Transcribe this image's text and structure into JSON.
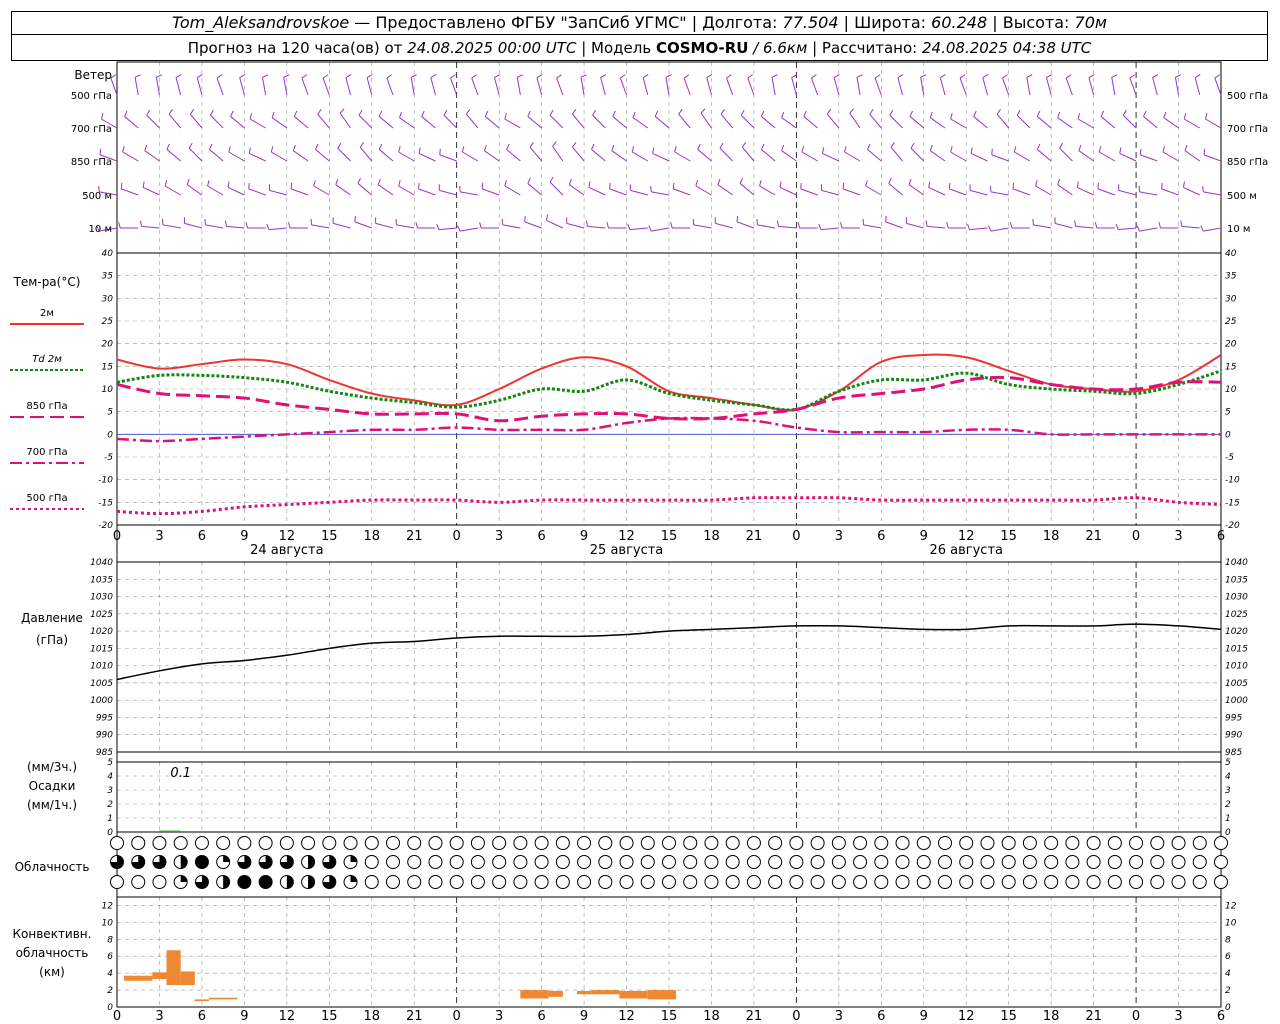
{
  "header": {
    "station": "Tom_Aleksandrovskoe",
    "provider": "— Предоставлено ФГБУ \"ЗапСиб УГМС\"",
    "lon_label": "Долгота:",
    "lon": "77.504",
    "lat_label": "Широта:",
    "lat": "60.248",
    "alt_label": "Высота:",
    "alt": "70м",
    "forecast_prefix": "Прогноз на 120 часа(ов) от",
    "forecast_start": "24.08.2025 00:00 UTC",
    "model_label": "Модель",
    "model": "COSMO-RU",
    "resolution": "/ 6.6км",
    "calc_label": "Рассчитано:",
    "calc_time": "24.08.2025 04:38 UTC"
  },
  "x_axis": {
    "hour_ticks": [
      "0",
      "3",
      "6",
      "9",
      "12",
      "15",
      "18",
      "21",
      "0",
      "3",
      "6",
      "9",
      "12",
      "15",
      "18",
      "21",
      "0",
      "3",
      "6",
      "9",
      "12",
      "15",
      "18",
      "21",
      "0",
      "3",
      "6"
    ],
    "days": [
      "24 августа",
      "25 августа",
      "26 августа"
    ]
  },
  "labels": {
    "wind_title": "Ветер",
    "wind_levels": [
      "500 гПа",
      "700 гПа",
      "850 гПа",
      "500 м",
      "10 м"
    ],
    "temp_title": "Тем-ра(°C)",
    "temp_legend": [
      "2м",
      "Td 2м",
      "850 гПа",
      "700 гПа",
      "500 гПа"
    ],
    "pressure_title": "Давление",
    "pressure_unit": "(гПа)",
    "precip_lines": [
      "(мм/3ч.)",
      "Осадки",
      "(мм/1ч.)"
    ],
    "precip_annotation": "0.1",
    "cloud_title": "Облачность",
    "conv_lines": [
      "Конвективн.",
      "облачность",
      "(км)"
    ]
  },
  "colors": {
    "t2m": "#ee3333",
    "td2m": "#118811",
    "t850": "#dd1177",
    "t700": "#dd1177",
    "t500": "#dd1177",
    "pressure": "#000000",
    "wind": "#9933cc",
    "precip": "#22aa22",
    "conv": "#ee8833",
    "zero_line": "#3344cc"
  },
  "chart_data": [
    {
      "type": "line",
      "ylabel": "Тем-ра(°C)",
      "ylim": [
        -20,
        40
      ],
      "y_ticks": [
        -20,
        -15,
        -10,
        -5,
        0,
        5,
        10,
        15,
        20,
        25,
        30,
        35,
        40
      ],
      "x_hours": [
        0,
        3,
        6,
        9,
        12,
        15,
        18,
        21,
        24,
        27,
        30,
        33,
        36,
        39,
        42,
        45,
        48,
        51,
        54,
        57,
        60,
        63,
        66,
        69,
        72,
        75,
        78
      ],
      "grid": true,
      "series": [
        {
          "name": "2м",
          "values": [
            16.5,
            14.5,
            15.5,
            16.5,
            15.5,
            12,
            9,
            7.5,
            6.5,
            10,
            14.5,
            17,
            15,
            9.5,
            8,
            6.5,
            5.5,
            9.5,
            16,
            17.5,
            17,
            14,
            11,
            10,
            9.5,
            12,
            17.5
          ]
        },
        {
          "name": "Td 2м",
          "values": [
            11.5,
            13,
            13,
            12.5,
            11.5,
            9.5,
            8,
            7,
            6,
            7.5,
            10,
            9.5,
            12,
            9,
            7.5,
            6.5,
            5.5,
            9.5,
            12,
            12,
            13.5,
            11,
            10,
            9.5,
            9,
            11,
            14
          ]
        },
        {
          "name": "850 гПа",
          "values": [
            11,
            9,
            8.5,
            8,
            6.5,
            5.5,
            4.5,
            4.5,
            4.5,
            3,
            4,
            4.5,
            4.5,
            3.5,
            3.5,
            4.5,
            5.5,
            8,
            9,
            10,
            12,
            12.5,
            11,
            10,
            10,
            11.5,
            11.5
          ]
        },
        {
          "name": "700 гПа",
          "values": [
            -1,
            -1.5,
            -1,
            -0.5,
            0,
            0.5,
            1,
            1,
            1.5,
            1,
            1,
            1,
            2.5,
            3.5,
            3.5,
            3,
            1.5,
            0.5,
            0.5,
            0.5,
            1,
            1,
            0,
            0,
            0,
            0,
            0
          ]
        },
        {
          "name": "500 гПа",
          "values": [
            -17,
            -17.5,
            -17,
            -16,
            -15.5,
            -15,
            -14.5,
            -14.5,
            -14.5,
            -15,
            -14.5,
            -14.5,
            -14.5,
            -14.5,
            -14.5,
            -14,
            -14,
            -14,
            -14.5,
            -14.5,
            -14.5,
            -14.5,
            -14.5,
            -14.5,
            -14,
            -15,
            -15.5
          ]
        }
      ]
    },
    {
      "type": "line",
      "ylabel": "Давление (гПа)",
      "ylim": [
        985,
        1040
      ],
      "y_ticks": [
        985,
        990,
        995,
        1000,
        1005,
        1010,
        1015,
        1020,
        1025,
        1030,
        1035,
        1040
      ],
      "x_hours": [
        0,
        3,
        6,
        9,
        12,
        15,
        18,
        21,
        24,
        27,
        30,
        33,
        36,
        39,
        42,
        45,
        48,
        51,
        54,
        57,
        60,
        63,
        66,
        69,
        72,
        75,
        78
      ],
      "grid": true,
      "series": [
        {
          "name": "Давление",
          "values": [
            1006,
            1008.5,
            1010.5,
            1011.5,
            1013,
            1015,
            1016.5,
            1017,
            1018,
            1018.5,
            1018.5,
            1018.5,
            1019,
            1020,
            1020.5,
            1021,
            1021.5,
            1021.5,
            1021,
            1020.5,
            1020.5,
            1021.5,
            1021.5,
            1021.5,
            1022,
            1021.5,
            1020.5
          ]
        }
      ]
    },
    {
      "type": "bar",
      "ylabel": "Осадки",
      "ylim": [
        0,
        5
      ],
      "y_ticks": [
        0,
        1,
        2,
        3,
        4,
        5
      ],
      "bars": [
        {
          "x_start": 3,
          "x_end": 4.5,
          "value": 0.1
        }
      ]
    },
    {
      "type": "heatmap",
      "ylabel": "Облачность",
      "x_step_hours": 1.5,
      "encoding": "octant coverage 0-4 per symbol (0 clear, 4 overcast)",
      "rows": [
        "00000000000000000000000000000000000000000000000000000000000000000000000000000000000000000000000000000000000000000000000000000000000000000000000000000000000000000000000000000000000000000000000000000000000000000000000000000000000000000000000000000000000000000000000000000000000000001231000000144",
        "3332413332310000000000000000000000000000000000000000002100000000000000000000000000000000000000000000000000000000000000000000000000000000000000000000000000000000000000000000000000000000000000000000000000000000000000000000000000000000000000000000000000000000000000000000000000000000000000314",
        "0001324422310000000000000000000000000000000000000000002444444000000000000000000000000000000000000000000000000000000000000000000000000000000000000000000000000000000000000000000000000000000000000000000000000000000000000000000000000000000000000000000000000000000000000000000012444000"
      ]
    },
    {
      "type": "bar",
      "ylabel": "Конвективн. облачность (км)",
      "ylim": [
        0,
        13
      ],
      "y_ticks": [
        0,
        2,
        4,
        6,
        8,
        10,
        12
      ],
      "bars": [
        {
          "x_start": 0.5,
          "x_end": 2.5,
          "bottom": 3.1,
          "top": 3.7
        },
        {
          "x_start": 2.5,
          "x_end": 3.5,
          "bottom": 3.3,
          "top": 4.1
        },
        {
          "x_start": 3.5,
          "x_end": 4.5,
          "bottom": 2.6,
          "top": 6.7
        },
        {
          "x_start": 4.5,
          "x_end": 5.5,
          "bottom": 2.6,
          "top": 4.2
        },
        {
          "x_start": 5.5,
          "x_end": 6.5,
          "bottom": 0.7,
          "top": 0.9
        },
        {
          "x_start": 6.5,
          "x_end": 8.5,
          "bottom": 0.9,
          "top": 1.1
        },
        {
          "x_start": 28.5,
          "x_end": 30.5,
          "bottom": 1.0,
          "top": 2.0
        },
        {
          "x_start": 30.5,
          "x_end": 31.5,
          "bottom": 1.2,
          "top": 1.9
        },
        {
          "x_start": 32.5,
          "x_end": 33.5,
          "bottom": 1.5,
          "top": 1.9
        },
        {
          "x_start": 33.5,
          "x_end": 35.5,
          "bottom": 1.5,
          "top": 2.0
        },
        {
          "x_start": 35.5,
          "x_end": 37.5,
          "bottom": 1.0,
          "top": 1.9
        },
        {
          "x_start": 37.5,
          "x_end": 39.5,
          "bottom": 0.9,
          "top": 2.0
        }
      ]
    }
  ],
  "wind_barbs": {
    "x_step_hours": 1.5,
    "rows_deg": [
      [
        340,
        350,
        350,
        345,
        345,
        340,
        345,
        350,
        350,
        340,
        340,
        345,
        345,
        340,
        350,
        345,
        340,
        340,
        345,
        350,
        345,
        340,
        350,
        345,
        340,
        345,
        350,
        340,
        345,
        340,
        340,
        350,
        345,
        340,
        345,
        350,
        340,
        345,
        350,
        345,
        340,
        345,
        340,
        350,
        345,
        340,
        345,
        350,
        340,
        345,
        350,
        345
      ],
      [
        300,
        310,
        315,
        320,
        320,
        315,
        310,
        300,
        305,
        310,
        320,
        325,
        315,
        310,
        305,
        310,
        315,
        320,
        310,
        300,
        310,
        315,
        320,
        315,
        310,
        305,
        310,
        320,
        325,
        320,
        315,
        310,
        305,
        310,
        320,
        325,
        320,
        315,
        310,
        305,
        300,
        310,
        320,
        315,
        310,
        305,
        300,
        310,
        315,
        310,
        305,
        300
      ],
      [
        290,
        300,
        305,
        310,
        315,
        310,
        300,
        295,
        300,
        305,
        310,
        315,
        320,
        310,
        300,
        295,
        290,
        300,
        305,
        310,
        320,
        325,
        320,
        310,
        305,
        300,
        295,
        300,
        310,
        315,
        320,
        310,
        305,
        300,
        295,
        300,
        310,
        320,
        315,
        305,
        300,
        295,
        290,
        300,
        310,
        315,
        305,
        300,
        295,
        290,
        300,
        305
      ],
      [
        280,
        290,
        295,
        300,
        305,
        300,
        295,
        290,
        285,
        290,
        300,
        305,
        310,
        305,
        300,
        290,
        285,
        280,
        290,
        300,
        310,
        315,
        305,
        295,
        290,
        285,
        280,
        290,
        300,
        305,
        310,
        300,
        295,
        290,
        285,
        290,
        300,
        310,
        305,
        295,
        290,
        285,
        280,
        290,
        300,
        305,
        295,
        290,
        285,
        280,
        290,
        295
      ],
      [
        260,
        270,
        275,
        280,
        285,
        280,
        275,
        270,
        265,
        270,
        280,
        285,
        290,
        285,
        280,
        270,
        265,
        260,
        270,
        280,
        290,
        295,
        285,
        275,
        270,
        265,
        260,
        270,
        280,
        285,
        290,
        280,
        275,
        270,
        265,
        270,
        280,
        290,
        285,
        275,
        270,
        265,
        260,
        270,
        280,
        285,
        275,
        270,
        265,
        260,
        270,
        275
      ]
    ]
  }
}
